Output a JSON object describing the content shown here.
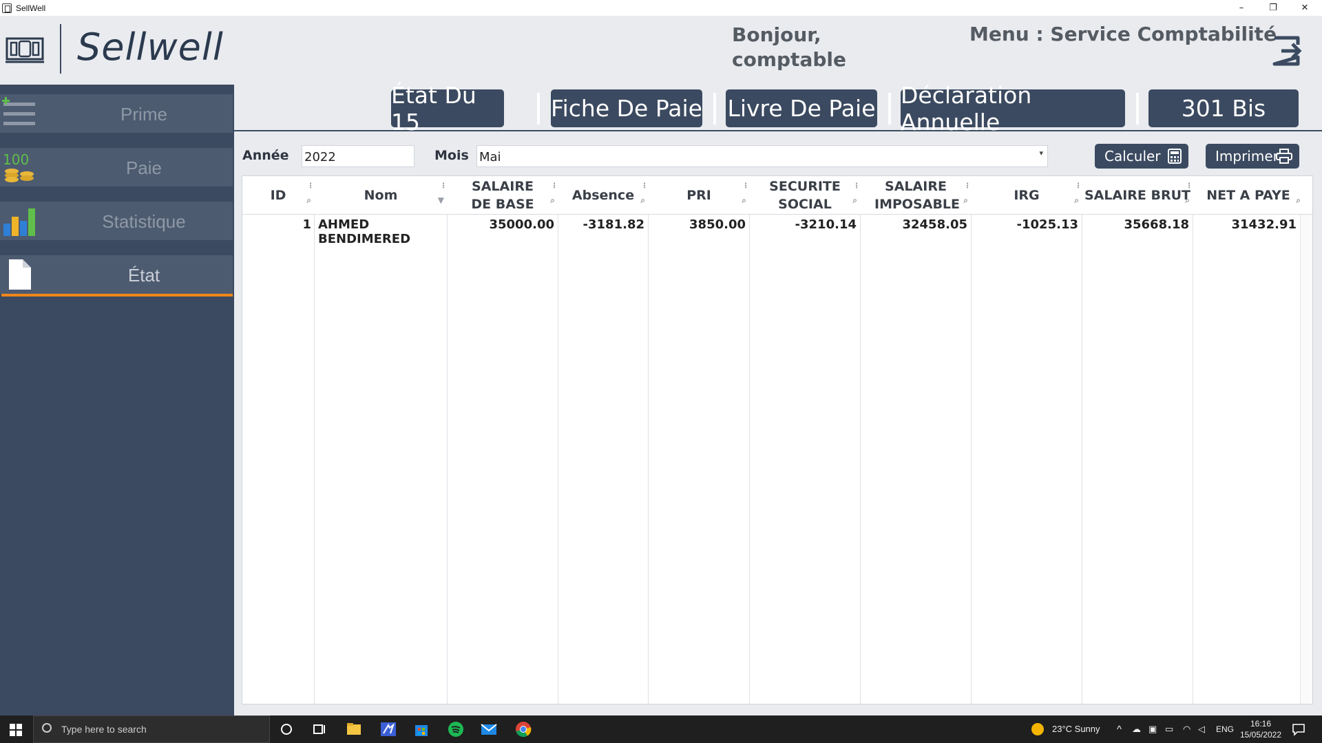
{
  "window": {
    "title": "SellWell",
    "minimize": "–",
    "maximize": "❐",
    "close": "✕"
  },
  "header": {
    "brand": "Sellwell",
    "greeting": "Bonjour, comptable",
    "menu_title": "Menu : Service Comptabilité"
  },
  "sidebar": {
    "items": [
      {
        "label": "Prime",
        "icon": "prime-list-icon"
      },
      {
        "label": "Paie",
        "icon": "coins-icon"
      },
      {
        "label": "Statistique",
        "icon": "bar-chart-icon"
      },
      {
        "label": "État",
        "icon": "document-icon"
      }
    ],
    "active": "État",
    "accent_color": "#f0861a"
  },
  "tabs": [
    "État Du 15",
    "Fiche De Paie",
    "Livre De Paie",
    "Déclaration Annuelle",
    "301 Bis"
  ],
  "filters": {
    "year_label": "Année",
    "year_value": "2022",
    "month_label": "Mois",
    "month_value": "Mai",
    "calc_label": "Calculer",
    "print_label": "Imprimer"
  },
  "table": {
    "columns": [
      "ID",
      "Nom",
      "SALAIRE DE BASE",
      "Absence",
      "PRI",
      "SECURITE SOCIAL",
      "SALAIRE IMPOSABLE",
      "IRG",
      "SALAIRE BRUT",
      "NET A PAYE"
    ],
    "rows": [
      [
        "1",
        "AHMED BENDIMERED",
        "35000.00",
        "-3181.82",
        "3850.00",
        "-3210.14",
        "32458.05",
        "-1025.13",
        "35668.18",
        "31432.91"
      ]
    ]
  },
  "taskbar": {
    "search_placeholder": "Type here to search",
    "weather": "23°C  Sunny",
    "lang": "ENG",
    "time": "16:16",
    "date": "15/05/2022"
  },
  "colors": {
    "primary": "#3b4a60",
    "sidebar_item": "#4d5b70",
    "background": "#e9ebef"
  }
}
